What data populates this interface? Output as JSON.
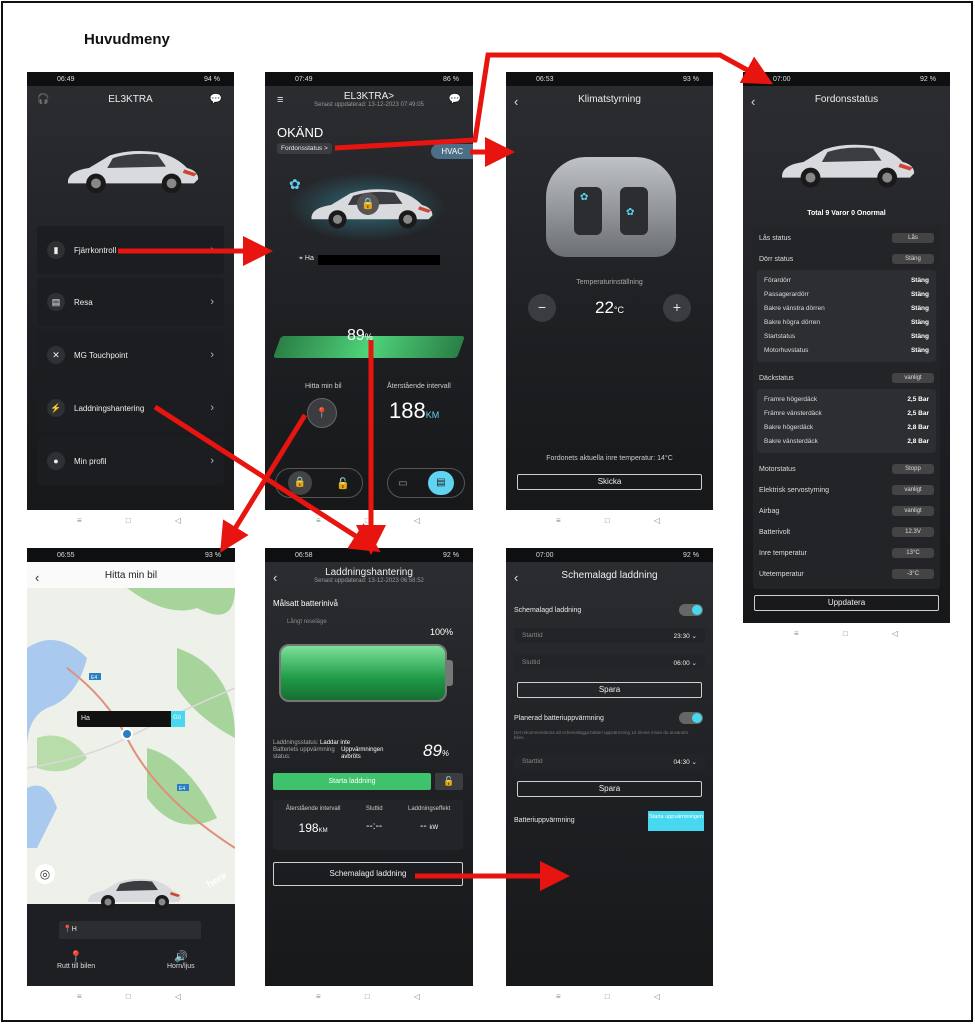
{
  "page_title": "Huvudmeny",
  "colors": {
    "arrow": "#e8140f",
    "accent": "#47d7ee",
    "green": "#3ec26b"
  },
  "s1": {
    "time": "06:49",
    "battery": "94 %",
    "title": "EL3KTRA",
    "items": [
      "Fjärrkontroll",
      "Resa",
      "MG Touchpoint",
      "Laddningshantering",
      "Min profil"
    ]
  },
  "s2": {
    "time": "07:49",
    "battery": "86 %",
    "title": "EL3KTRA>",
    "updated": "Senast uppdaterad: 13-12-2023 07:49:05",
    "status": "OKÄND",
    "status_link": "Fordonsstatus >",
    "hvac": "HVAC",
    "location": "Ha",
    "soc": "89",
    "soc_unit": "%",
    "find_label": "Hitta min bil",
    "range_label": "Återstående intervall",
    "range_value": "188",
    "range_unit": "KM"
  },
  "s3": {
    "time": "06:53",
    "battery": "93 %",
    "title": "Klimatstyrning",
    "temp_label": "Temperaturinställning",
    "temp": "22",
    "temp_unit": "°C",
    "minus": "−",
    "plus": "+",
    "inner_temp": "Fordonets aktuella inre temperatur: 14°C",
    "send": "Skicka"
  },
  "s4": {
    "time": "07:00",
    "battery": "92 %",
    "title": "Fordonsstatus",
    "summary": "Total 9 Varor 0 Onormal",
    "lock_status": "Lås status",
    "lock_value": "Lås",
    "door_status": "Dörr status",
    "door_value": "Stäng",
    "doors": [
      [
        "Förardörr",
        "Stäng"
      ],
      [
        "Passagerardörr",
        "Stäng"
      ],
      [
        "Bakre vänstra dörren",
        "Stäng"
      ],
      [
        "Bakre högra dörren",
        "Stäng"
      ],
      [
        "Startstatus",
        "Stäng"
      ],
      [
        "Motorhuvstatus",
        "Stäng"
      ]
    ],
    "tire_status": "Däckstatus",
    "tire_value": "vanligt",
    "tires": [
      [
        "Framre högerdäck",
        "2,5 Bar"
      ],
      [
        "Främre vänsterdäck",
        "2,5 Bar"
      ],
      [
        "Bakre högerdäck",
        "2,8 Bar"
      ],
      [
        "Bakre vänsterdäck",
        "2,8 Bar"
      ]
    ],
    "others": [
      [
        "Motorstatus",
        "Stopp"
      ],
      [
        "Elektrisk servostyrning",
        "vanligt"
      ],
      [
        "Airbag",
        "vanligt"
      ],
      [
        "Batterivolt",
        "12.3V"
      ],
      [
        "Inre temperatur",
        "13°C"
      ],
      [
        "Utetemperatur",
        "-3°C"
      ]
    ],
    "update": "Uppdatera"
  },
  "s5": {
    "time": "06:55",
    "battery": "93 %",
    "title": "Hitta min bil",
    "map_label": "Ha",
    "map_label2": "Gö",
    "road1": "E4",
    "road2": "E4",
    "here": "here",
    "address": "H",
    "route": "Rutt till bilen",
    "horn": "Horn/ljus"
  },
  "s6": {
    "time": "06:58",
    "battery": "92 %",
    "title": "Laddningshantering",
    "updated": "Senast uppdaterad: 13-12-2023 06:58:52",
    "target": "Målsatt batterinivå",
    "long_trip": "Långt reseläge",
    "target_pct": "100%",
    "charge_status_l": "Laddningsstatus:",
    "charge_status_v": "Laddar inte",
    "preheat_l": "Batteriets uppvärmning status:",
    "preheat_v": "Uppvärmningen avbröts",
    "soc": "89",
    "soc_unit": "%",
    "start": "Starta laddning",
    "col1": "Återstående intervall",
    "col2": "Sluttid",
    "col3": "Laddningseffekt",
    "v1": "198",
    "v1u": "KM",
    "v2": "--:--",
    "v3": "--",
    "v3u": "kW",
    "schedule": "Schemalagd laddning"
  },
  "s7": {
    "time": "07:00",
    "battery": "92 %",
    "title": "Schemalagd laddning",
    "sched": "Schemalagd laddning",
    "start_ph": "Starttid",
    "start_v": "23:30",
    "end_ph": "Sluttid",
    "end_v": "06:00",
    "save": "Spara",
    "preheat": "Planerad batteriuppvärmning",
    "preheat_note": "Det rekommenderas att schemalägga batteri uppvärmning 15 timme innan du använder bilen.",
    "pstart_ph": "Starttid",
    "pstart_v": "04:30",
    "save2": "Spara",
    "heat_label": "Batteriuppvärmning",
    "heat_btn": "Starta uppvärmningen"
  },
  "nav": [
    "≡",
    "□",
    "◁"
  ]
}
